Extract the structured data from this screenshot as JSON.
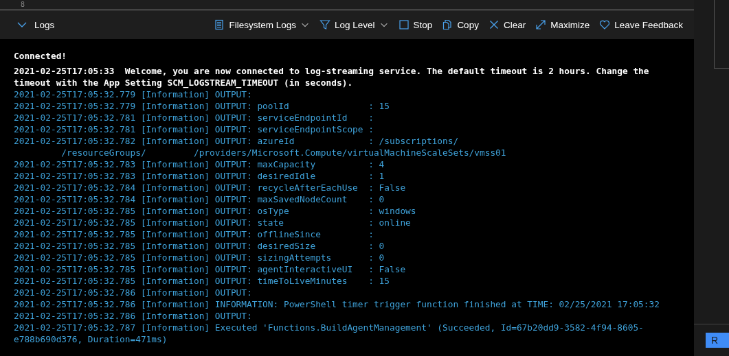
{
  "editor": {
    "line_number": "8"
  },
  "toolbar": {
    "toggle": {
      "label": "Logs"
    },
    "actions": [
      {
        "label": "Filesystem Logs",
        "dropdown": true
      },
      {
        "label": "Log Level",
        "dropdown": true
      },
      {
        "label": "Stop",
        "dropdown": false
      },
      {
        "label": "Copy",
        "dropdown": false
      },
      {
        "label": "Clear",
        "dropdown": false
      },
      {
        "label": "Maximize",
        "dropdown": false
      },
      {
        "label": "Leave Feedback",
        "dropdown": false
      }
    ]
  },
  "log": {
    "status": "Connected!",
    "lines": [
      {
        "kind": "notice",
        "text": "2021-02-25T17:05:33  Welcome, you are now connected to log-streaming service. The default timeout is 2 hours. Change the timeout with the App Setting SCM_LOGSTREAM_TIMEOUT (in seconds)."
      },
      {
        "kind": "info",
        "text": "2021-02-25T17:05:32.779 [Information] OUTPUT:"
      },
      {
        "kind": "info",
        "text": "2021-02-25T17:05:32.779 [Information] OUTPUT: poolId               : 15"
      },
      {
        "kind": "info",
        "text": "2021-02-25T17:05:32.781 [Information] OUTPUT: serviceEndpointId    :"
      },
      {
        "kind": "info",
        "text": "2021-02-25T17:05:32.781 [Information] OUTPUT: serviceEndpointScope :"
      },
      {
        "kind": "info",
        "text": "2021-02-25T17:05:32.782 [Information] OUTPUT: azureId              : /subscriptions/"
      },
      {
        "kind": "info",
        "text": "         /resourceGroups/         /providers/Microsoft.Compute/virtualMachineScaleSets/vmss01"
      },
      {
        "kind": "info",
        "text": "2021-02-25T17:05:32.783 [Information] OUTPUT: maxCapacity          : 4"
      },
      {
        "kind": "info",
        "text": "2021-02-25T17:05:32.783 [Information] OUTPUT: desiredIdle          : 1"
      },
      {
        "kind": "info",
        "text": "2021-02-25T17:05:32.784 [Information] OUTPUT: recycleAfterEachUse  : False"
      },
      {
        "kind": "info",
        "text": "2021-02-25T17:05:32.784 [Information] OUTPUT: maxSavedNodeCount    : 0"
      },
      {
        "kind": "info",
        "text": "2021-02-25T17:05:32.785 [Information] OUTPUT: osType               : windows"
      },
      {
        "kind": "info",
        "text": "2021-02-25T17:05:32.785 [Information] OUTPUT: state                : online"
      },
      {
        "kind": "info",
        "text": "2021-02-25T17:05:32.785 [Information] OUTPUT: offlineSince         :"
      },
      {
        "kind": "info",
        "text": "2021-02-25T17:05:32.785 [Information] OUTPUT: desiredSize          : 0"
      },
      {
        "kind": "info",
        "text": "2021-02-25T17:05:32.785 [Information] OUTPUT: sizingAttempts       : 0"
      },
      {
        "kind": "info",
        "text": "2021-02-25T17:05:32.785 [Information] OUTPUT: agentInteractiveUI   : False"
      },
      {
        "kind": "info",
        "text": "2021-02-25T17:05:32.785 [Information] OUTPUT: timeToLiveMinutes    : 15"
      },
      {
        "kind": "info",
        "text": "2021-02-25T17:05:32.786 [Information] OUTPUT:"
      },
      {
        "kind": "info",
        "text": "2021-02-25T17:05:32.786 [Information] INFORMATION: PowerShell timer trigger function finished at TIME: 02/25/2021 17:05:32"
      },
      {
        "kind": "info",
        "text": "2021-02-25T17:05:32.786 [Information] OUTPUT:"
      },
      {
        "kind": "info",
        "text": "2021-02-25T17:05:32.787 [Information] Executed 'Functions.BuildAgentManagement' (Succeeded, Id=67b20dd9-3582-4f94-8605-e788b690d376, Duration=471ms)"
      }
    ]
  },
  "side": {
    "button": "R"
  }
}
